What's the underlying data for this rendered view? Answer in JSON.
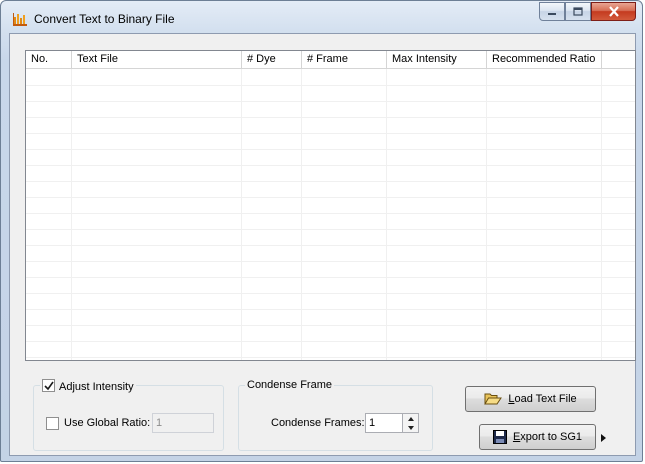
{
  "window": {
    "title": "Convert Text to Binary File"
  },
  "list": {
    "columns": [
      "No.",
      "Text File",
      "# Dye",
      "# Frame",
      "Max Intensity",
      "Recommended Ratio"
    ],
    "rows": []
  },
  "adjust": {
    "label": "Adjust Intensity",
    "checked": true,
    "global_ratio_label": "Use Global Ratio:",
    "global_ratio_checked": false,
    "global_ratio_value": "1"
  },
  "condense": {
    "group_label": "Condense Frame",
    "frames_label": "Condense Frames:",
    "frames_value": "1"
  },
  "buttons": {
    "load_mnemonic": "L",
    "load_rest": "oad Text File",
    "export_mnemonic": "E",
    "export_rest": "xport to SG1"
  }
}
